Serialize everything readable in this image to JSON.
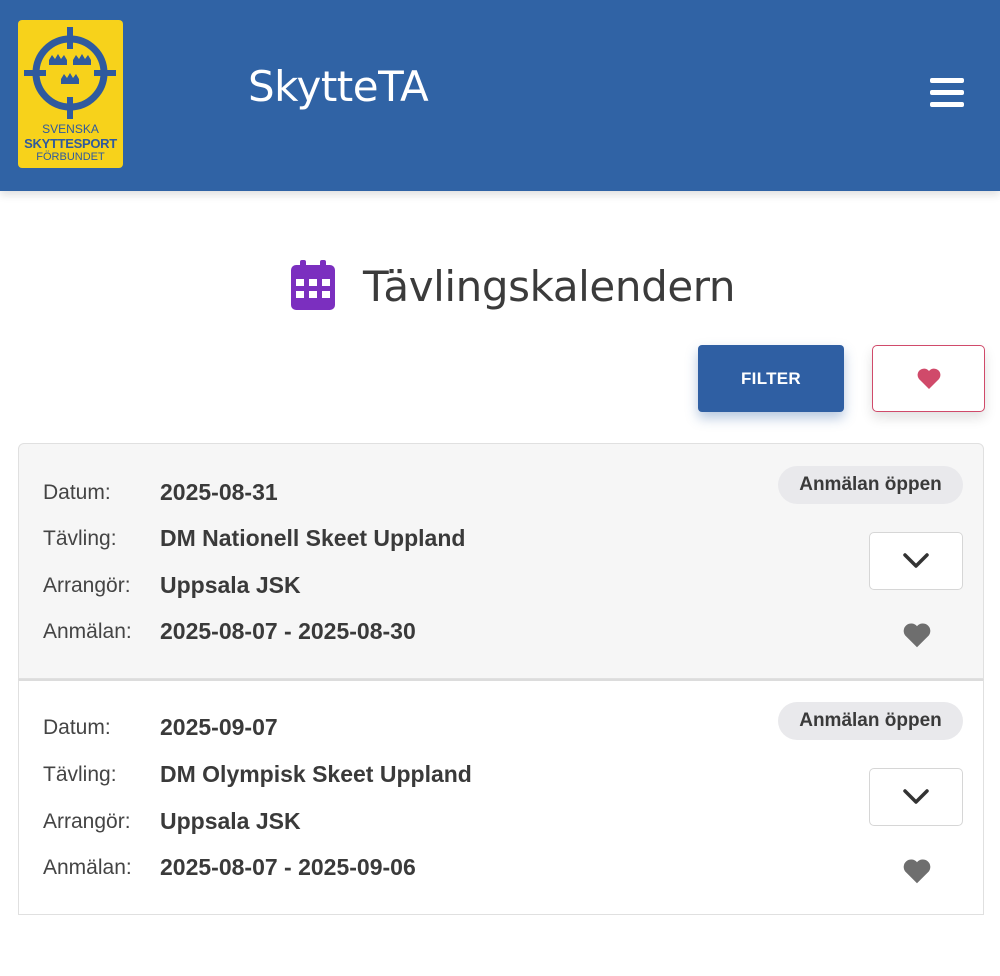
{
  "header": {
    "logo": {
      "line1": "SVENSKA",
      "line2": "SKYTTESPORT",
      "line3": "FÖRBUNDET",
      "icon": "crosshair-three-crowns"
    },
    "app_title": "SkytteTA",
    "menu_icon": "hamburger-menu-icon"
  },
  "page": {
    "title": "Tävlingskalendern",
    "title_icon": "calendar-icon",
    "filter_label": "FILTER",
    "favorites_icon": "heart-icon"
  },
  "colors": {
    "header": "#3063a5",
    "button": "#2f5fa3",
    "heart_accent": "#d04a6a",
    "calendar_icon": "#7b2fbf",
    "logo_bg": "#f7d21b"
  },
  "labels": {
    "date": "Datum:",
    "competition": "Tävling:",
    "organizer": "Arrangör:",
    "registration": "Anmälan:"
  },
  "competitions": [
    {
      "date": "2025-08-31",
      "name": "DM Nationell Skeet Uppland",
      "organizer": "Uppsala JSK",
      "registration": "2025-08-07 - 2025-08-30",
      "status": "Anmälan öppen"
    },
    {
      "date": "2025-09-07",
      "name": "DM Olympisk Skeet Uppland",
      "organizer": "Uppsala JSK",
      "registration": "2025-08-07 - 2025-09-06",
      "status": "Anmälan öppen"
    }
  ]
}
